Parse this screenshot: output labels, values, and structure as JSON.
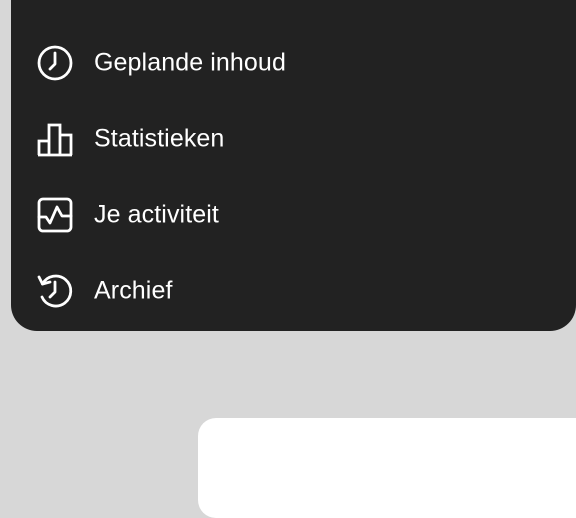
{
  "menu": {
    "items": [
      {
        "label": "",
        "icon": "bookmark-icon"
      },
      {
        "label": "Geplande inhoud",
        "icon": "clock-icon"
      },
      {
        "label": "Statistieken",
        "icon": "bar-chart-icon"
      },
      {
        "label": "Je activiteit",
        "icon": "activity-icon"
      },
      {
        "label": "Archief",
        "icon": "archive-history-icon"
      }
    ]
  },
  "colors": {
    "menu_background": "#222222",
    "page_background": "#d7d7d7",
    "text": "#ffffff",
    "highlight_ring": "#c0202a",
    "card": "#ffffff"
  }
}
